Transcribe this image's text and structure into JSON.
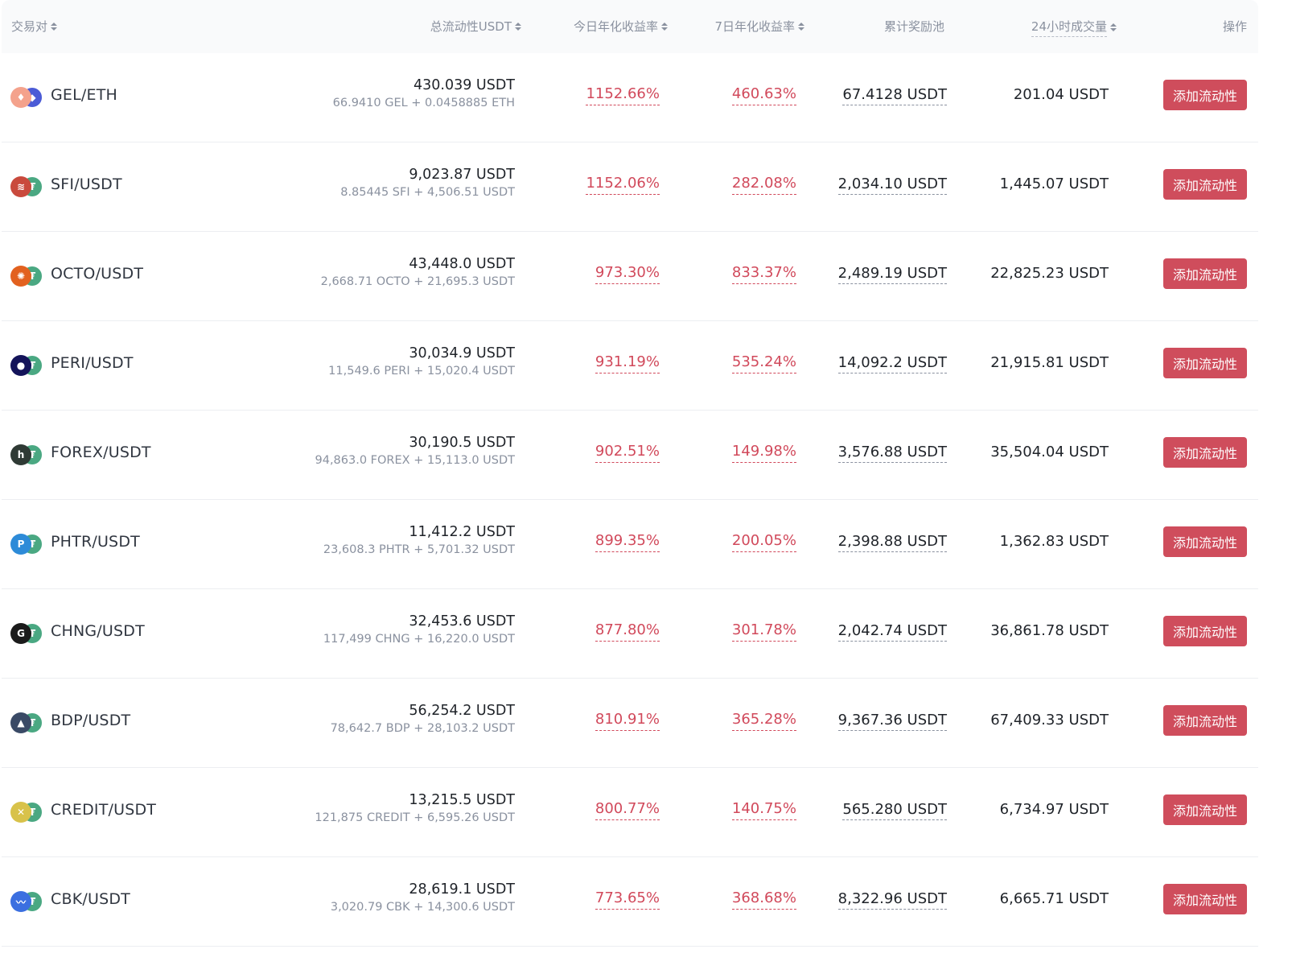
{
  "header": {
    "pair": "交易对",
    "liquidity": "总流动性USDT",
    "apr_today": "今日年化收益率",
    "apr_7d": "7日年化收益率",
    "reward_pool": "累计奖励池",
    "volume_24h": "24小时成交量",
    "action": "操作"
  },
  "rows": [
    {
      "pair": "GEL/ETH",
      "base_icon": "gel-icon",
      "quote_icon": "eth-icon",
      "base_color": "#f4a28c",
      "quote_color": "#4b5bd6",
      "liquidity": "430.039 USDT",
      "composition": "66.9410 GEL + 0.0458885 ETH",
      "apr_today": "1152.66%",
      "apr_7d": "460.63%",
      "reward_pool": "67.4128 USDT",
      "volume_24h": "201.04 USDT",
      "action": "添加流动性"
    },
    {
      "pair": "SFI/USDT",
      "base_icon": "sfi-icon",
      "quote_icon": "usdt-icon",
      "base_color": "#c94a3d",
      "quote_color": "#4aa882",
      "liquidity": "9,023.87 USDT",
      "composition": "8.85445 SFI + 4,506.51 USDT",
      "apr_today": "1152.06%",
      "apr_7d": "282.08%",
      "reward_pool": "2,034.10 USDT",
      "volume_24h": "1,445.07 USDT",
      "action": "添加流动性"
    },
    {
      "pair": "OCTO/USDT",
      "base_icon": "octo-icon",
      "quote_icon": "usdt-icon",
      "base_color": "#e2611f",
      "quote_color": "#4aa882",
      "liquidity": "43,448.0 USDT",
      "composition": "2,668.71 OCTO + 21,695.3 USDT",
      "apr_today": "973.30%",
      "apr_7d": "833.37%",
      "reward_pool": "2,489.19 USDT",
      "volume_24h": "22,825.23 USDT",
      "action": "添加流动性"
    },
    {
      "pair": "PERI/USDT",
      "base_icon": "peri-icon",
      "quote_icon": "usdt-icon",
      "base_color": "#14145a",
      "quote_color": "#4aa882",
      "liquidity": "30,034.9 USDT",
      "composition": "11,549.6 PERI + 15,020.4 USDT",
      "apr_today": "931.19%",
      "apr_7d": "535.24%",
      "reward_pool": "14,092.2 USDT",
      "volume_24h": "21,915.81 USDT",
      "action": "添加流动性"
    },
    {
      "pair": "FOREX/USDT",
      "base_icon": "forex-icon",
      "quote_icon": "usdt-icon",
      "base_color": "#2f3a35",
      "quote_color": "#4aa882",
      "liquidity": "30,190.5 USDT",
      "composition": "94,863.0 FOREX + 15,113.0 USDT",
      "apr_today": "902.51%",
      "apr_7d": "149.98%",
      "reward_pool": "3,576.88 USDT",
      "volume_24h": "35,504.04 USDT",
      "action": "添加流动性"
    },
    {
      "pair": "PHTR/USDT",
      "base_icon": "phtr-icon",
      "quote_icon": "usdt-icon",
      "base_color": "#2d8bd8",
      "quote_color": "#4aa882",
      "liquidity": "11,412.2 USDT",
      "composition": "23,608.3 PHTR + 5,701.32 USDT",
      "apr_today": "899.35%",
      "apr_7d": "200.05%",
      "reward_pool": "2,398.88 USDT",
      "volume_24h": "1,362.83 USDT",
      "action": "添加流动性"
    },
    {
      "pair": "CHNG/USDT",
      "base_icon": "chng-icon",
      "quote_icon": "usdt-icon",
      "base_color": "#1b1b1b",
      "quote_color": "#4aa882",
      "liquidity": "32,453.6 USDT",
      "composition": "117,499 CHNG + 16,220.0 USDT",
      "apr_today": "877.80%",
      "apr_7d": "301.78%",
      "reward_pool": "2,042.74 USDT",
      "volume_24h": "36,861.78 USDT",
      "action": "添加流动性"
    },
    {
      "pair": "BDP/USDT",
      "base_icon": "bdp-icon",
      "quote_icon": "usdt-icon",
      "base_color": "#3a4a66",
      "quote_color": "#4aa882",
      "liquidity": "56,254.2 USDT",
      "composition": "78,642.7 BDP + 28,103.2 USDT",
      "apr_today": "810.91%",
      "apr_7d": "365.28%",
      "reward_pool": "9,367.36 USDT",
      "volume_24h": "67,409.33 USDT",
      "action": "添加流动性"
    },
    {
      "pair": "CREDIT/USDT",
      "base_icon": "credit-icon",
      "quote_icon": "usdt-icon",
      "base_color": "#d8c24a",
      "quote_color": "#4aa882",
      "liquidity": "13,215.5 USDT",
      "composition": "121,875 CREDIT + 6,595.26 USDT",
      "apr_today": "800.77%",
      "apr_7d": "140.75%",
      "reward_pool": "565.280 USDT",
      "volume_24h": "6,734.97 USDT",
      "action": "添加流动性"
    },
    {
      "pair": "CBK/USDT",
      "base_icon": "cbk-icon",
      "quote_icon": "usdt-icon",
      "base_color": "#3b6fe0",
      "quote_color": "#4aa882",
      "liquidity": "28,619.1 USDT",
      "composition": "3,020.79 CBK + 14,300.6 USDT",
      "apr_today": "773.65%",
      "apr_7d": "368.68%",
      "reward_pool": "8,322.96 USDT",
      "volume_24h": "6,665.71 USDT",
      "action": "添加流动性"
    }
  ]
}
